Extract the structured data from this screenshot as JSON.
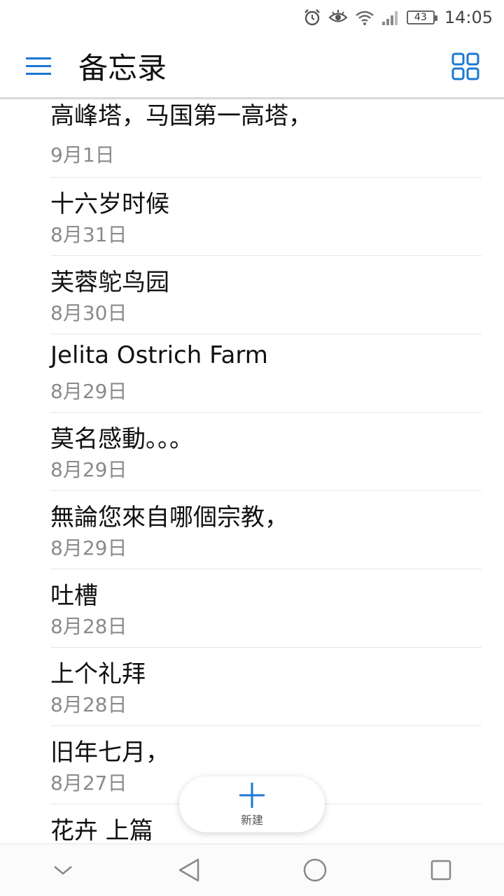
{
  "status_bar": {
    "battery_level": "43",
    "time": "14:05"
  },
  "app_bar": {
    "title": "备忘录"
  },
  "notes": [
    {
      "title": "高峰塔，马国第一高塔，",
      "date": "9月1日"
    },
    {
      "title": "十六岁时候",
      "date": "8月31日"
    },
    {
      "title": "芙蓉鸵鸟园",
      "date": "8月30日"
    },
    {
      "title": "Jelita Ostrich Farm",
      "date": "8月29日"
    },
    {
      "title": "莫名感動。。。",
      "date": "8月29日"
    },
    {
      "title": "無論您來自哪個宗教，",
      "date": "8月29日"
    },
    {
      "title": "吐槽",
      "date": "8月28日"
    },
    {
      "title": "上个礼拜",
      "date": "8月28日"
    },
    {
      "title": "旧年七月，",
      "date": "8月27日"
    },
    {
      "title": "花卉 上篇",
      "date": ""
    }
  ],
  "fab": {
    "label": "新建"
  },
  "colors": {
    "accent": "#1a78d2"
  }
}
